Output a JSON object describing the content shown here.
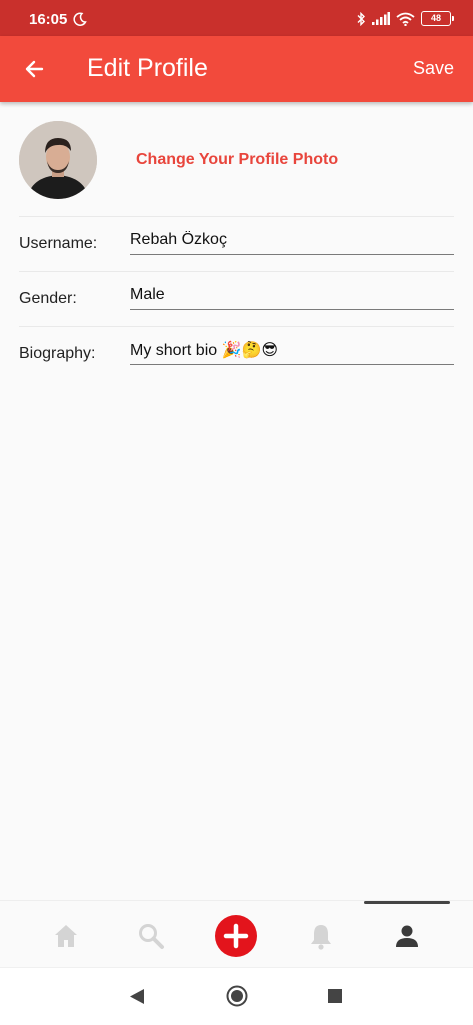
{
  "status_bar": {
    "time": "16:05",
    "battery": "48",
    "icons": [
      "moon-icon",
      "bluetooth-icon",
      "signal-icon",
      "wifi-icon",
      "battery-icon"
    ]
  },
  "app_bar": {
    "title": "Edit Profile",
    "save_label": "Save",
    "background": "#f24a3c"
  },
  "profile": {
    "change_photo_label": "Change Your Profile Photo"
  },
  "fields": [
    {
      "label": "Username:",
      "value": "Rebah Özkoç"
    },
    {
      "label": "Gender:",
      "value": "Male"
    },
    {
      "label": "Biography:",
      "value": "My short bio 🎉🤔😎"
    }
  ],
  "bottom_nav": {
    "items": [
      "home-icon",
      "search-icon",
      "add-icon",
      "bell-icon",
      "person-icon"
    ],
    "active": "person-icon",
    "accent": "#e3141c"
  },
  "system_nav": [
    "back-triangle-icon",
    "home-circle-icon",
    "recents-square-icon"
  ]
}
